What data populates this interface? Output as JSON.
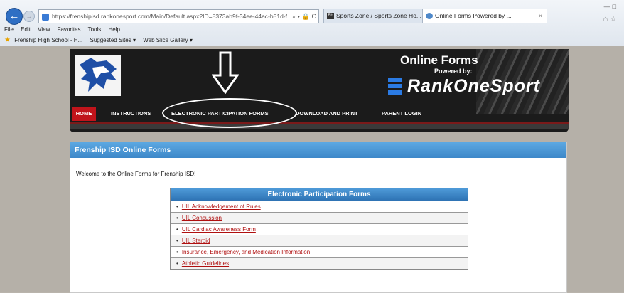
{
  "browser": {
    "url": "https://frenshipisd.rankonesport.com/Main/Default.aspx?ID=8373ab9f-34ee-44ac-b51d-f",
    "url_tail": "⌕ ▾ 🔒 C",
    "tabs": [
      {
        "label": "Sports Zone / Sports Zone Ho...",
        "icon": "Bb"
      },
      {
        "label": "Online Forms Powered by ...",
        "close": "×"
      }
    ],
    "menu": [
      "File",
      "Edit",
      "View",
      "Favorites",
      "Tools",
      "Help"
    ],
    "favorites": [
      "Frenship High School - H...",
      "Suggested Sites ▾",
      "Web Slice Gallery ▾"
    ]
  },
  "header": {
    "title": "Online Forms",
    "subtitle": "Powered by:",
    "brand": "RankOneSport",
    "nav": [
      "HOME",
      "INSTRUCTIONS",
      "ELECTRONIC PARTICIPATION FORMS",
      "DOWNLOAD AND PRINT",
      "PARENT LOGIN"
    ]
  },
  "content": {
    "title": "Frenship ISD Online Forms",
    "welcome": "Welcome to the Online Forms for Frenship ISD!",
    "forms_title": "Electronic Participation Forms",
    "forms": [
      "UIL Acknowledgement of Rules",
      "UIL Concussion",
      "UIL Cardiac Awareness Form",
      "UIL Steroid",
      "Insurance, Emergency, and Medication Information",
      "Athletic Guidelines"
    ]
  },
  "colors": {
    "accent": "#c0141b",
    "panel_blue": "#3d88c9",
    "link": "#b01010"
  }
}
